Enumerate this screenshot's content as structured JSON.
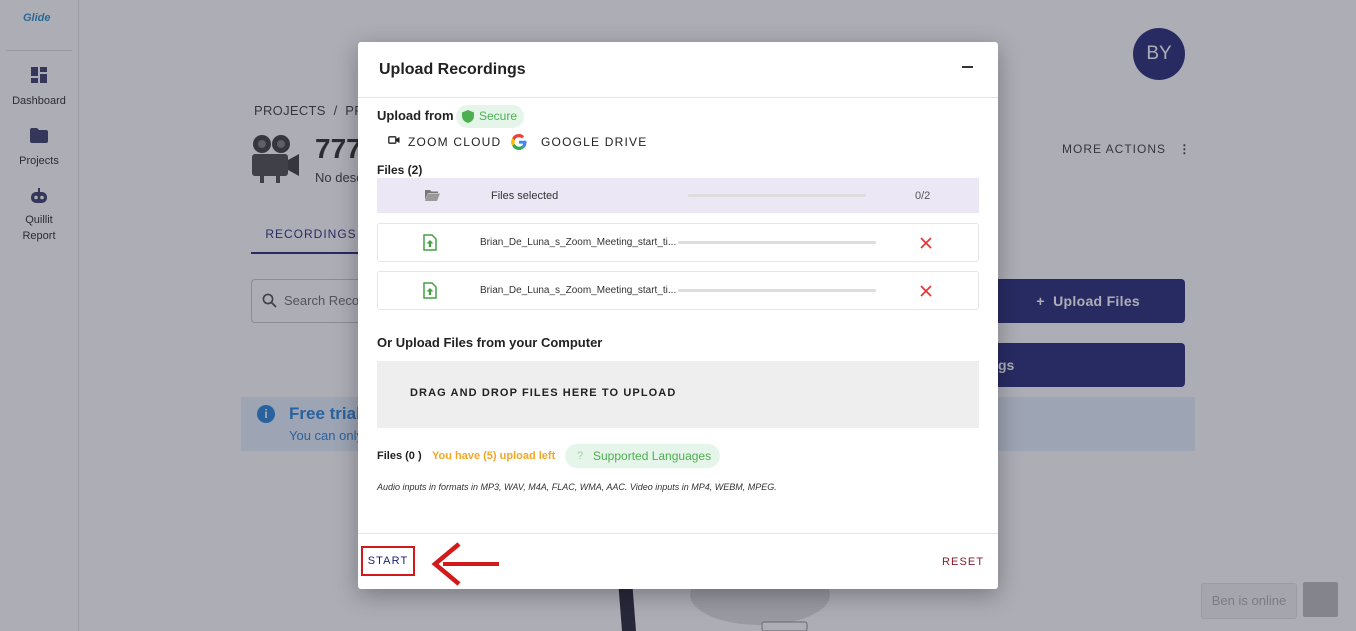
{
  "app": {
    "logo_text": "Glide",
    "nav": [
      {
        "label": "Dashboard",
        "icon": "dashboard-icon"
      },
      {
        "label": "Projects",
        "icon": "folder-icon"
      },
      {
        "label": "Quillit Report",
        "icon": "robot-icon"
      }
    ],
    "avatar_initials": "BY",
    "breadcrumb": "PROJECTS  /  PR",
    "project_title": "777",
    "project_desc": "No desc",
    "more_actions": "MORE ACTIONS",
    "tab_recordings": "RECORDINGS",
    "search_placeholder": "Search Reco",
    "upload_files_button": "+  Upload Files",
    "upload_recordings_button": "gs",
    "trial_title": "Free trial",
    "trial_sub": "You can only",
    "chat_status": "Ben is online"
  },
  "modal": {
    "title": "Upload Recordings",
    "upload_from_label": "Upload from",
    "secure_label": "Secure",
    "sources": [
      "ZOOM CLOUD",
      "GOOGLE DRIVE"
    ],
    "files_heading": "Files (2)",
    "files_selected_label": "Files selected",
    "files_selected_count": "0/2",
    "files_selected_progress": 0,
    "files": [
      {
        "name": "Brian_De_Luna_s_Zoom_Meeting_start_ti...",
        "progress": 0
      },
      {
        "name": "Brian_De_Luna_s_Zoom_Meeting_start_ti...",
        "progress": 0
      }
    ],
    "computer_upload_heading": "Or Upload Files from your Computer",
    "dropzone_text": "DRAG AND DROP FILES HERE TO UPLOAD",
    "files_count": "Files (0 )",
    "uploads_left": "You have (5) upload left",
    "supported_languages": "Supported Languages",
    "formats_note": "Audio inputs in formats in MP3, WAV, M4A, FLAC, WMA, AAC. Video inputs in MP4, WEBM, MPEG.",
    "start_button": "START",
    "reset_button": "RESET"
  },
  "colors": {
    "navy": "#1a1f6e",
    "secure_green": "#4caf50",
    "warning_orange": "#f5a623",
    "remove_red": "#e53935",
    "annotation_red": "#d21a1a",
    "reset_color": "#8b1a2e"
  }
}
